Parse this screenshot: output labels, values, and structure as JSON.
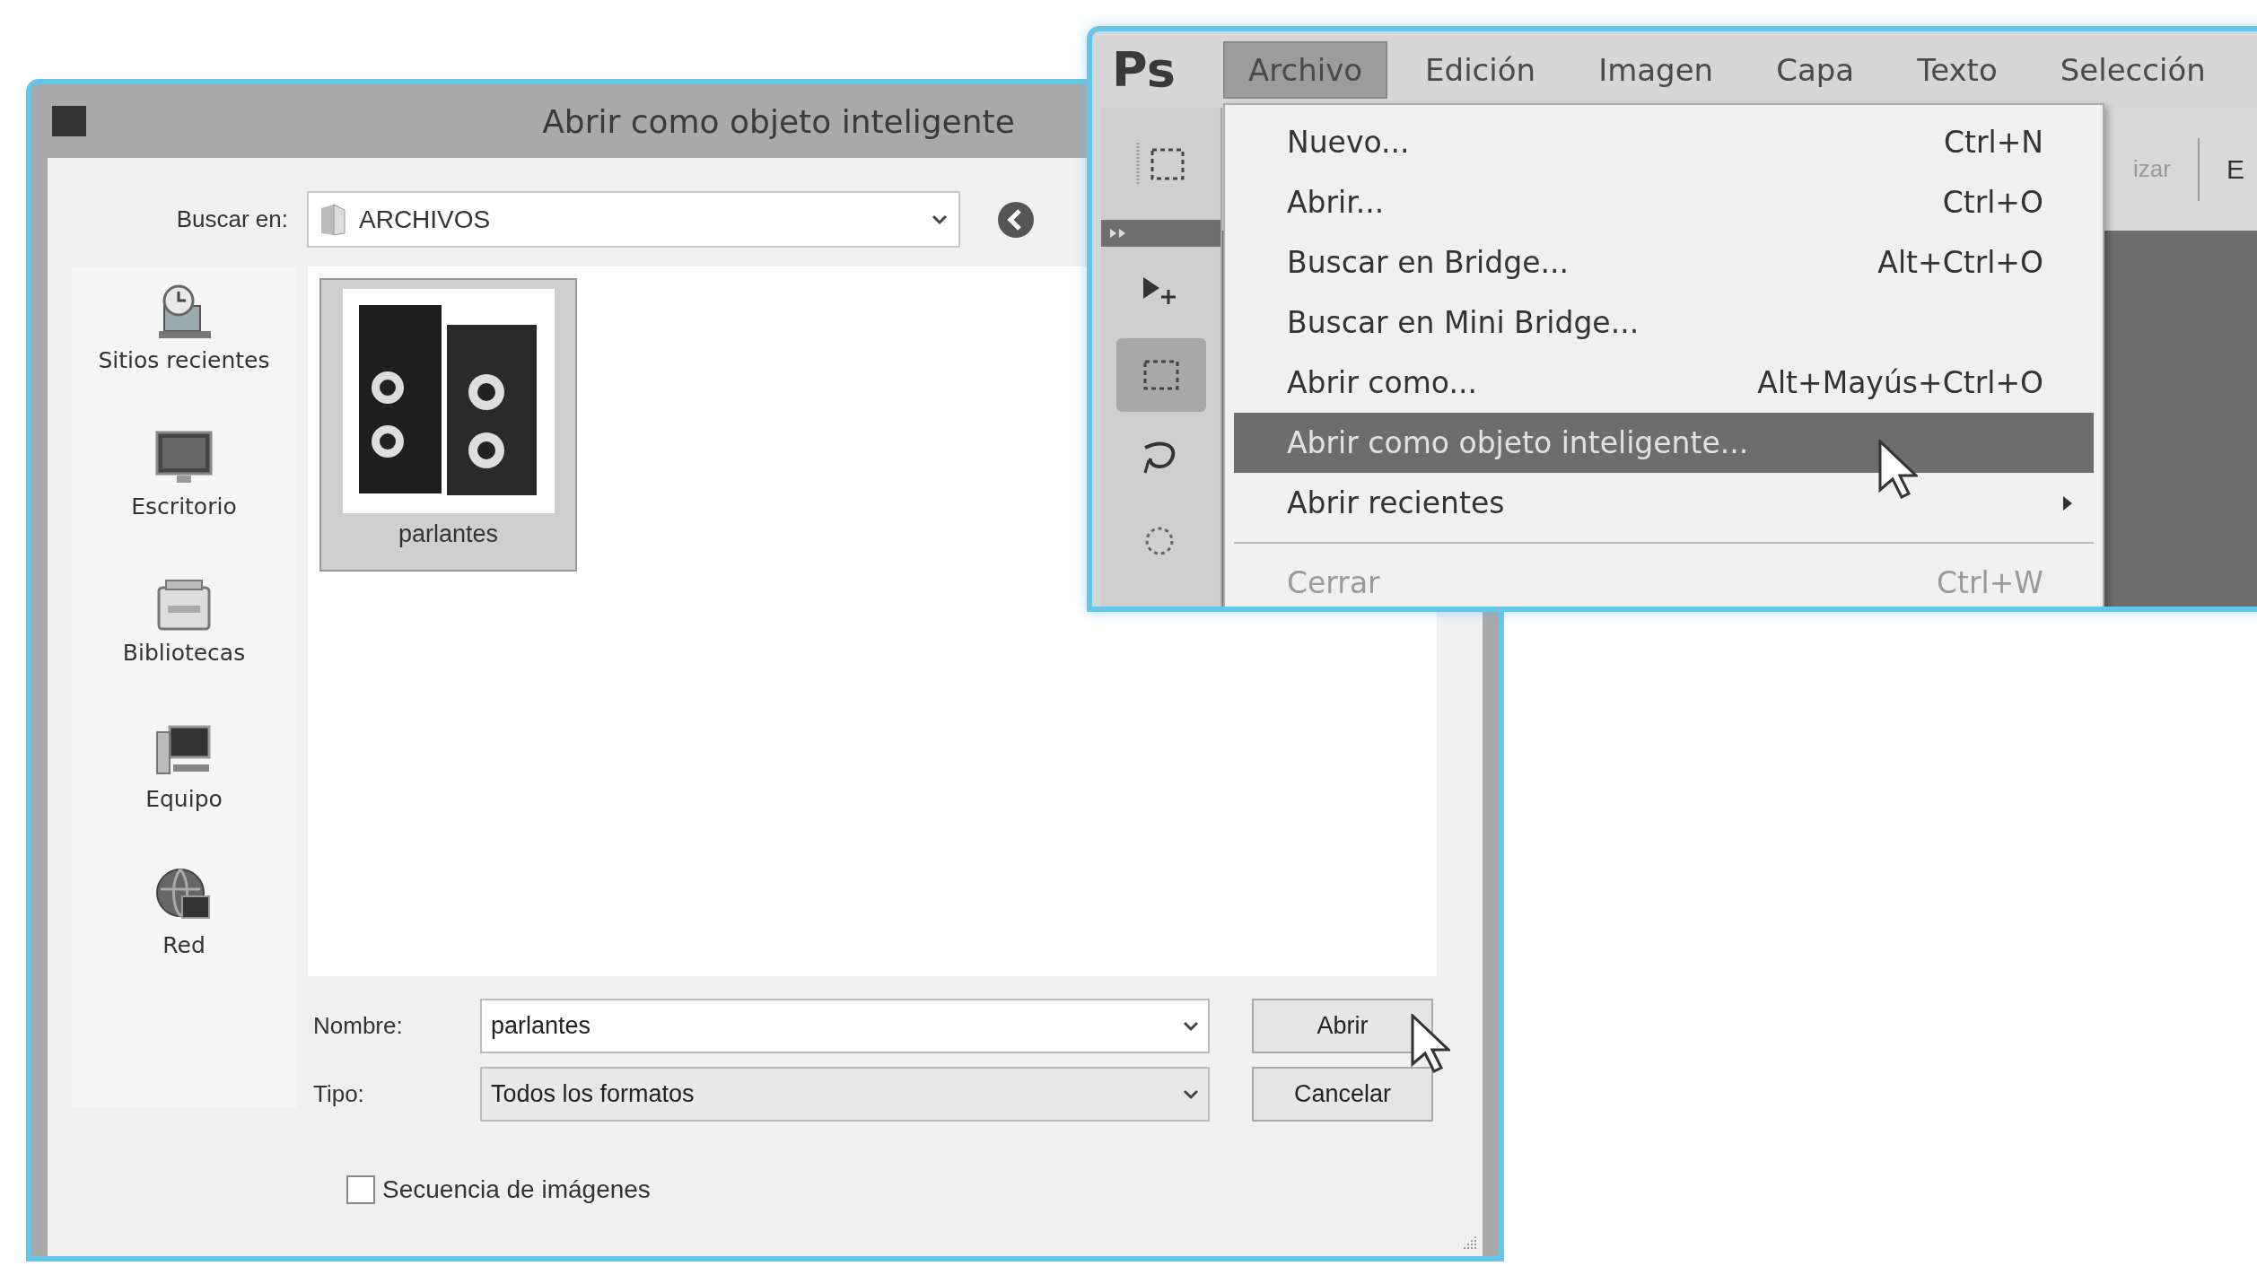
{
  "dialog": {
    "title": "Abrir como objeto inteligente",
    "look_in": {
      "label": "Buscar en:",
      "value": "ARCHIVOS"
    },
    "places": [
      {
        "label": "Sitios recientes"
      },
      {
        "label": "Escritorio"
      },
      {
        "label": "Bibliotecas"
      },
      {
        "label": "Equipo"
      },
      {
        "label": "Red"
      }
    ],
    "files": [
      {
        "name": "parlantes",
        "selected": true
      }
    ],
    "name_field": {
      "label": "Nombre:",
      "value": "parlantes"
    },
    "type_field": {
      "label": "Tipo:",
      "value": "Todos los formatos"
    },
    "buttons": [
      {
        "label": "Abrir"
      },
      {
        "label": "Cancelar"
      }
    ],
    "sequence_checkbox": {
      "label": "Secuencia de imágenes",
      "checked": false
    }
  },
  "photoshop": {
    "logo": "Ps",
    "menubar": [
      {
        "label": "Archivo",
        "selected": true
      },
      {
        "label": "Edición",
        "selected": false
      },
      {
        "label": "Imagen",
        "selected": false
      },
      {
        "label": "Capa",
        "selected": false
      },
      {
        "label": "Texto",
        "selected": false
      },
      {
        "label": "Selección",
        "selected": false
      }
    ],
    "tools": [
      {
        "selected": false
      },
      {
        "selected": true
      },
      {
        "selected": false
      },
      {
        "selected": false
      }
    ],
    "toolbar_texts": [
      "izar",
      "E"
    ],
    "file_menu": [
      {
        "kind": "item",
        "label": "Nuevo...",
        "shortcut": "Ctrl+N",
        "selected": false,
        "disabled": false,
        "submenu": false
      },
      {
        "kind": "item",
        "label": "Abrir...",
        "shortcut": "Ctrl+O",
        "selected": false,
        "disabled": false,
        "submenu": false
      },
      {
        "kind": "item",
        "label": "Buscar en Bridge...",
        "shortcut": "Alt+Ctrl+O",
        "selected": false,
        "disabled": false,
        "submenu": false
      },
      {
        "kind": "item",
        "label": "Buscar en Mini Bridge...",
        "selected": false,
        "disabled": false,
        "submenu": false
      },
      {
        "kind": "item",
        "label": "Abrir como...",
        "shortcut": "Alt+Mayús+Ctrl+O",
        "selected": false,
        "disabled": false,
        "submenu": false
      },
      {
        "kind": "item",
        "label": "Abrir como objeto inteligente...",
        "selected": true,
        "disabled": false,
        "submenu": false
      },
      {
        "kind": "item",
        "label": "Abrir recientes",
        "selected": false,
        "disabled": false,
        "submenu": true
      },
      {
        "kind": "separator"
      },
      {
        "kind": "item",
        "label": "Cerrar",
        "shortcut": "Ctrl+W",
        "selected": false,
        "disabled": true,
        "submenu": false
      }
    ]
  }
}
